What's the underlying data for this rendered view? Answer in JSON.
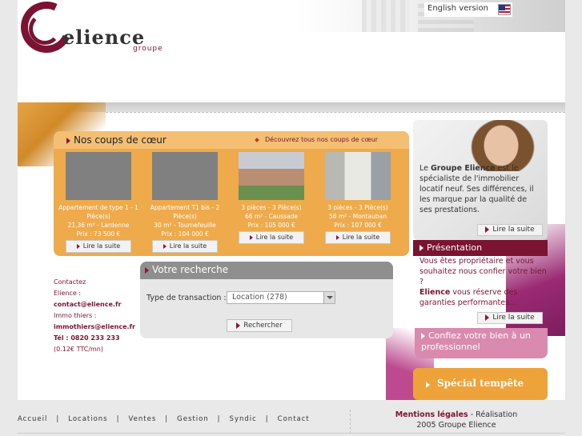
{
  "header": {
    "logo_word": "elience",
    "logo_sub": "groupe",
    "language_link": "English version"
  },
  "favourites": {
    "title": "Nos coups de cœur",
    "see_all_link": "Découvrez tous nos coups de cœur",
    "cards": [
      {
        "line1": "Appartement de type 1 - 1 Pièce(s)",
        "line2": "21,36 m² - Lardenne",
        "price": "Prix : 73 500 €",
        "button": "Lire la suite"
      },
      {
        "line1": "Appartement T1 bis - 2 Pièce(s)",
        "line2": "30 m² - Tournefeuille",
        "price": "Prix : 104 000 €",
        "button": "Lire la suite"
      },
      {
        "line1": "3 pièces - 3 Pièce(s)",
        "line2": "66 m² - Caussade",
        "price": "Prix : 105 000 €",
        "button": "Lire la suite"
      },
      {
        "line1": "3 pièces - 3 Pièce(s)",
        "line2": "56 m² - Montauban",
        "price": "Prix : 107 000 €",
        "button": "Lire la suite"
      }
    ]
  },
  "contact": {
    "heading": "Contactez",
    "elience_label": "Elience :",
    "elience_email": "contact@elience.fr",
    "immo_label": "Immo thiers :",
    "immo_email": "immothiers@elience.fr",
    "phone": "Tél : 0820 233 233",
    "phone_rate": "(0.12€ TTC/mn)"
  },
  "search": {
    "title": "Votre recherche",
    "transaction_label": "Type de transaction :",
    "transaction_value": "Location (278)",
    "submit": "Rechercher"
  },
  "intro": {
    "text_prefix": "Le ",
    "text_bold": "Groupe Elience",
    "text_rest": " est le spécialiste de l'immobilier locatif neuf. Ses différences, il les marque par la qualité de ses prestations.",
    "button": "Lire la suite"
  },
  "presentation": {
    "title": "Présentation",
    "text_start": "Vous êtes propriétaire et vous souhaitez nous confier votre bien ?",
    "text_bold": "Elience",
    "text_end": " vous réserve des garanties performantes...",
    "button": "Lire la suite"
  },
  "confiez": "Confiez votre bien à un professionnel",
  "tempete": "Spécial tempête",
  "footer": {
    "nav": [
      "Accueil",
      "Locations",
      "Ventes",
      "Gestion",
      "Syndic",
      "Contact"
    ],
    "separator": "|",
    "legal_bold": "Mentions légales",
    "legal_rest": " - Réalisation",
    "copyright": "2005 Groupe Elience"
  },
  "colors": {
    "brand": "#7b1332",
    "orange": "#eeaa4b",
    "pink": "#d98aae"
  }
}
